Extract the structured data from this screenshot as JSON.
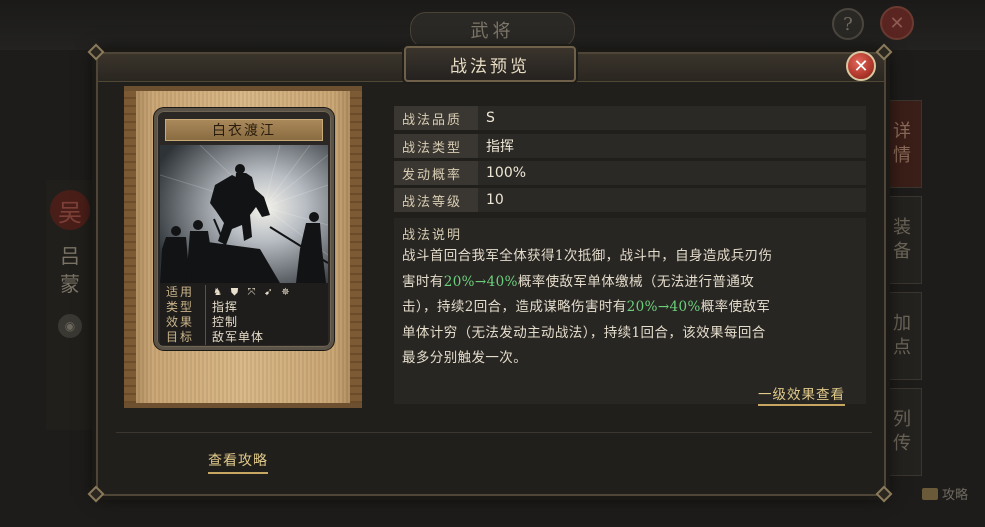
{
  "background": {
    "title": "武将",
    "help_glyph": "?",
    "close_glyph": "✕",
    "faction": "吴",
    "hero_name": [
      "吕",
      "蒙"
    ],
    "side_tabs": [
      {
        "chars": [
          "详",
          "情"
        ],
        "active": true
      },
      {
        "chars": [
          "装",
          "备"
        ],
        "active": false
      },
      {
        "chars": [
          "加",
          "点"
        ],
        "active": false
      },
      {
        "chars": [
          "列",
          "传"
        ],
        "active": false
      }
    ],
    "guide_label": "攻略"
  },
  "modal": {
    "title": "战法预览",
    "close_glyph": "✕",
    "guide_link": "查看攻略"
  },
  "card": {
    "name": "白衣渡江",
    "rows": [
      {
        "key": "适用",
        "icons": [
          "cavalry-icon",
          "shield-icon",
          "bow-icon",
          "spear-icon",
          "machine-icon"
        ]
      },
      {
        "key": "类型",
        "value": "指挥"
      },
      {
        "key": "效果",
        "value": "控制"
      },
      {
        "key": "目标",
        "value": "敌军单体"
      }
    ]
  },
  "attributes": [
    {
      "key": "战法品质",
      "value": "S"
    },
    {
      "key": "战法类型",
      "value": "指挥"
    },
    {
      "key": "发动概率",
      "value": "100%"
    },
    {
      "key": "战法等级",
      "value": "10"
    }
  ],
  "description": {
    "title": "战法说明",
    "lines": [
      [
        {
          "t": "战斗首回合我军全体获得1次抵御，战斗中，自身造成兵刃伤"
        }
      ],
      [
        {
          "t": "害时有"
        },
        {
          "t": "20%→40%",
          "hl": true
        },
        {
          "t": "概率使敌军单体缴械（无法进行普通攻"
        }
      ],
      [
        {
          "t": "击），持续2回合，造成谋略伤害时有"
        },
        {
          "t": "20%→40%",
          "hl": true
        },
        {
          "t": "概率使敌军"
        }
      ],
      [
        {
          "t": "单体计穷（无法发动主动战法），持续1回合，该效果每回合"
        }
      ],
      [
        {
          "t": "最多分别触发一次。"
        }
      ]
    ],
    "detail_link": "一级效果查看"
  },
  "colors": {
    "highlight": "#6ccf7c",
    "link": "#e0c98a",
    "close_red": "#b0372c"
  }
}
